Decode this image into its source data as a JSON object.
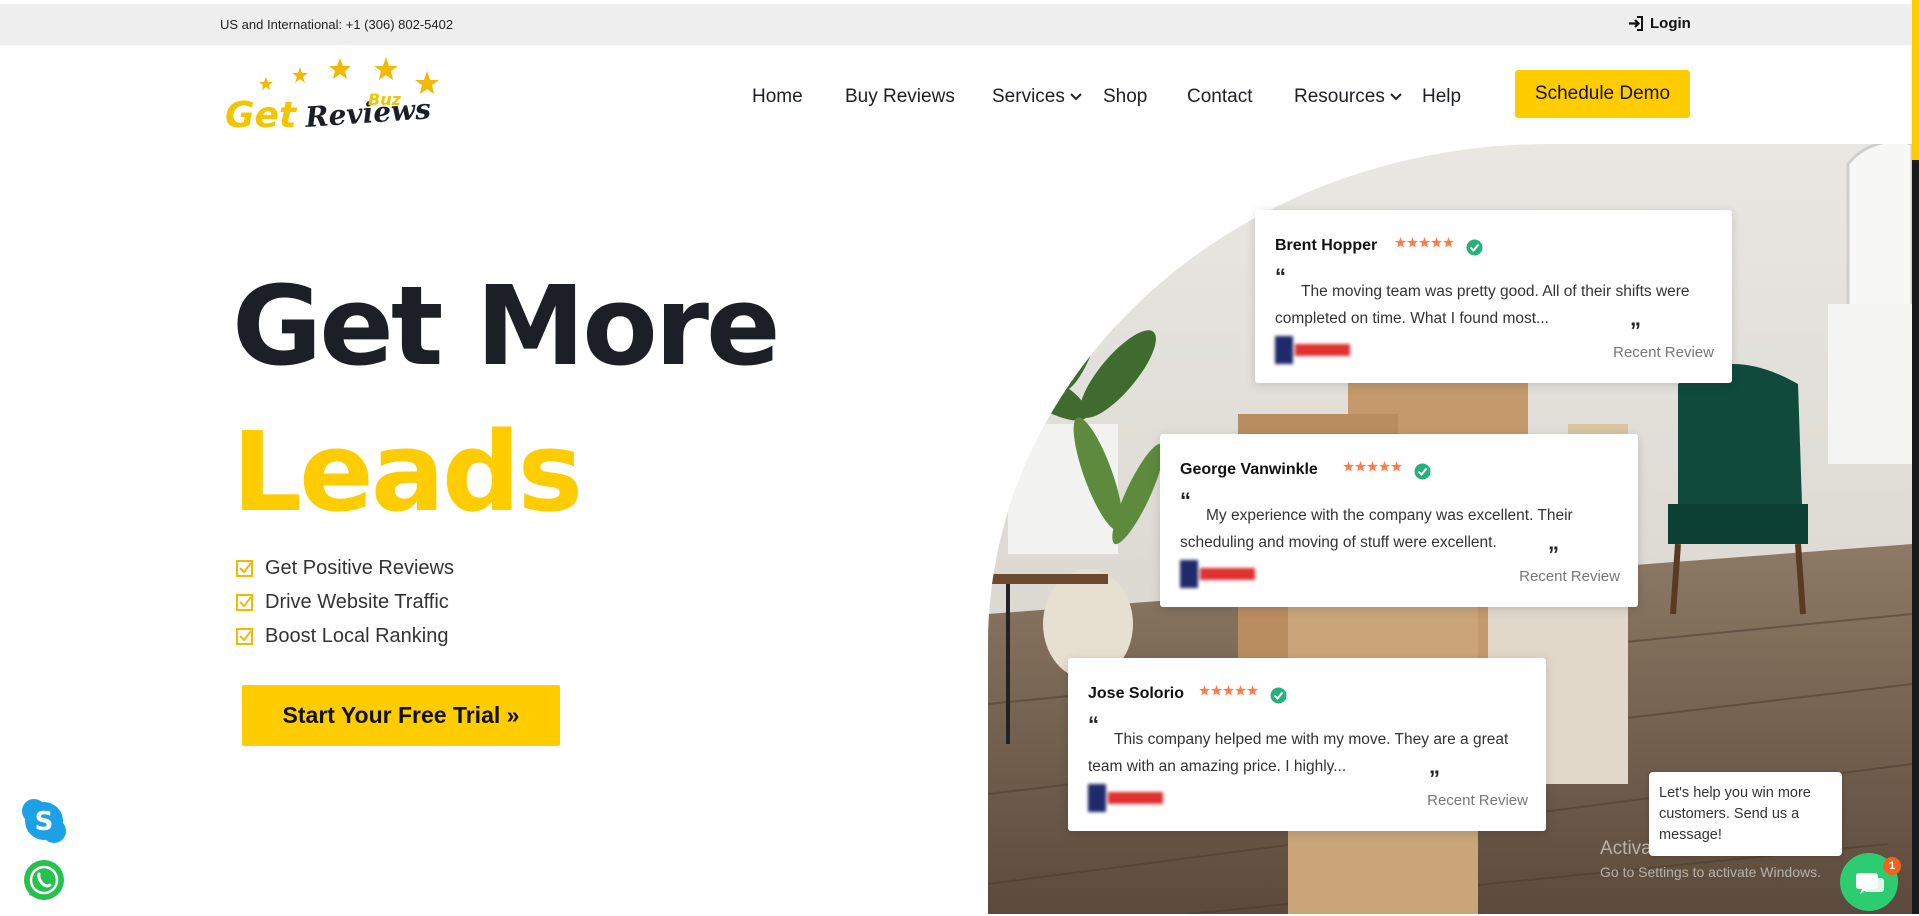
{
  "topbar": {
    "phone": "US and International: +1 (306) 802-5402",
    "login": "Login"
  },
  "logo": {
    "word1": "Get",
    "word2": "Reviews",
    "word3": "Buz"
  },
  "nav": {
    "home": "Home",
    "buy_reviews": "Buy Reviews",
    "services": "Services",
    "shop": "Shop",
    "contact": "Contact",
    "resources": "Resources",
    "help": "Help",
    "schedule_demo": "Schedule Demo"
  },
  "hero": {
    "line1": "Get More",
    "line2": "Leads",
    "bullets": [
      "Get Positive Reviews",
      "Drive Website Traffic",
      "Boost Local Ranking"
    ],
    "cta": "Start Your Free Trial »"
  },
  "reviews": [
    {
      "name": "Brent Hopper",
      "rating": 5,
      "text": "The moving team was pretty good. All of their shifts were completed on time. What I found most...",
      "link": "Recent Review"
    },
    {
      "name": "George Vanwinkle",
      "rating": 5,
      "text": "My experience with the company was excellent. Their scheduling and moving of stuff were excellent.",
      "link": "Recent Review"
    },
    {
      "name": "Jose Solorio",
      "rating": 5,
      "text": "This company helped me with my move. They are a great team with an amazing price. I highly...",
      "link": "Recent Review"
    }
  ],
  "quote_marks": {
    "open": "“",
    "close": "”"
  },
  "chat": {
    "message": "Let's help you win more customers. Send us a message!",
    "badge": "1"
  },
  "watermark": {
    "line1": "Activate Windows",
    "line2": "Go to Settings to activate Windows."
  },
  "icons": {
    "login": "login-icon",
    "chevron": "chevron-down-icon",
    "check": "checkbox-icon",
    "star": "star-icon",
    "verified": "verified-icon",
    "skype": "skype-icon",
    "whatsapp": "whatsapp-icon",
    "chat": "chat-icon"
  },
  "colors": {
    "accent": "#ffcc00",
    "dark": "#1c1f26",
    "star": "#ff7a45",
    "verified": "#27b07a",
    "chat": "#2ecc71",
    "topbar": "#eeeeee"
  }
}
